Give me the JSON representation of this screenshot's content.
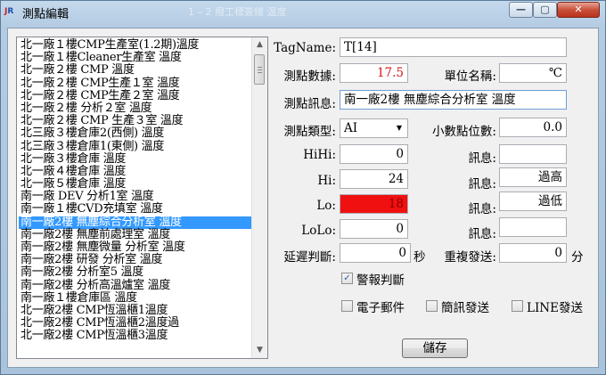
{
  "window": {
    "title": "測點編輯",
    "ghost_title": "1 – 2 撥工標簽總 温度",
    "min_glyph": "—",
    "max_glyph": "▢",
    "close_glyph": "✕"
  },
  "list": {
    "items": [
      "北一廠１樓CMP生產室(1.2期)溫度",
      "北一廠１樓Cleaner生產室 溫度",
      "北一廠２樓 CMP 溫度",
      "北一廠２樓 CMP生產１室 溫度",
      "北一廠２樓 CMP生產２室 溫度",
      "北一廠２樓 分析２室 溫度",
      "北一廠２樓 CMP 生產３室 溫度",
      "北三廠３樓倉庫2(西側) 溫度",
      "北三廠３樓倉庫1(東側) 溫度",
      "北一廠３樓倉庫 溫度",
      "北一廠４樓倉庫 溫度",
      "北一廠５樓倉庫 溫度",
      "南一廠 DEV 分析1室 溫度",
      "南一廠１樓CVD充填室 溫度",
      "南一廠2樓 無塵綜合分析室 溫度",
      "南一廠2樓 無塵前處理室 溫度",
      "南一廠2樓 無塵微量 分析室 溫度",
      "南一廠2樓 研發 分析室 溫度",
      "南一廠2樓 分析室5 溫度",
      "南一廠2樓 分析高溫爐室 溫度",
      "南一廠１樓倉庫區 溫度",
      "北一廠2樓 CMP恆溫櫃1溫度",
      "北一廠2樓 CMP恆溫櫃2溫度過",
      "北一廠2樓 CMP恆溫櫃3溫度"
    ],
    "selected_index": 14
  },
  "form": {
    "tagname_label": "TagName:",
    "tagname_value": "T[14]",
    "value_label": "測點數據:",
    "value_value": "17.5",
    "unit_label": "單位名稱:",
    "unit_value": "℃",
    "message_label": "測點訊息:",
    "message_value": "南一廠2樓 無塵綜合分析室 溫度",
    "type_label": "測點類型:",
    "type_value": "AI",
    "decimals_label": "小數點位數:",
    "decimals_value": "0.0",
    "hihi_label": "HiHi:",
    "hihi_value": "0",
    "hihi_msg_label": "訊息:",
    "hihi_msg_value": "",
    "hi_label": "Hi:",
    "hi_value": "24",
    "hi_msg_label": "訊息:",
    "hi_msg_value": "過高",
    "lo_label": "Lo:",
    "lo_value": "18",
    "lo_msg_label": "訊息:",
    "lo_msg_value": "過低",
    "lolo_label": "LoLo:",
    "lolo_value": "0",
    "lolo_msg_label": "訊息:",
    "lolo_msg_value": "",
    "delay_label": "延遲判斷:",
    "delay_value": "0",
    "delay_unit": "秒",
    "repeat_label": "重複發送:",
    "repeat_value": "0",
    "repeat_unit": "分",
    "alarm_check_label": "警報判斷",
    "alarm_checked": true,
    "email_label": "電子郵件",
    "sms_label": "簡訊發送",
    "line_label": "LINE發送",
    "save_label": "儲存"
  },
  "colors": {
    "alarm_bg": "#f01010",
    "value_text": "#d21b1b",
    "selection": "#3399ff"
  }
}
